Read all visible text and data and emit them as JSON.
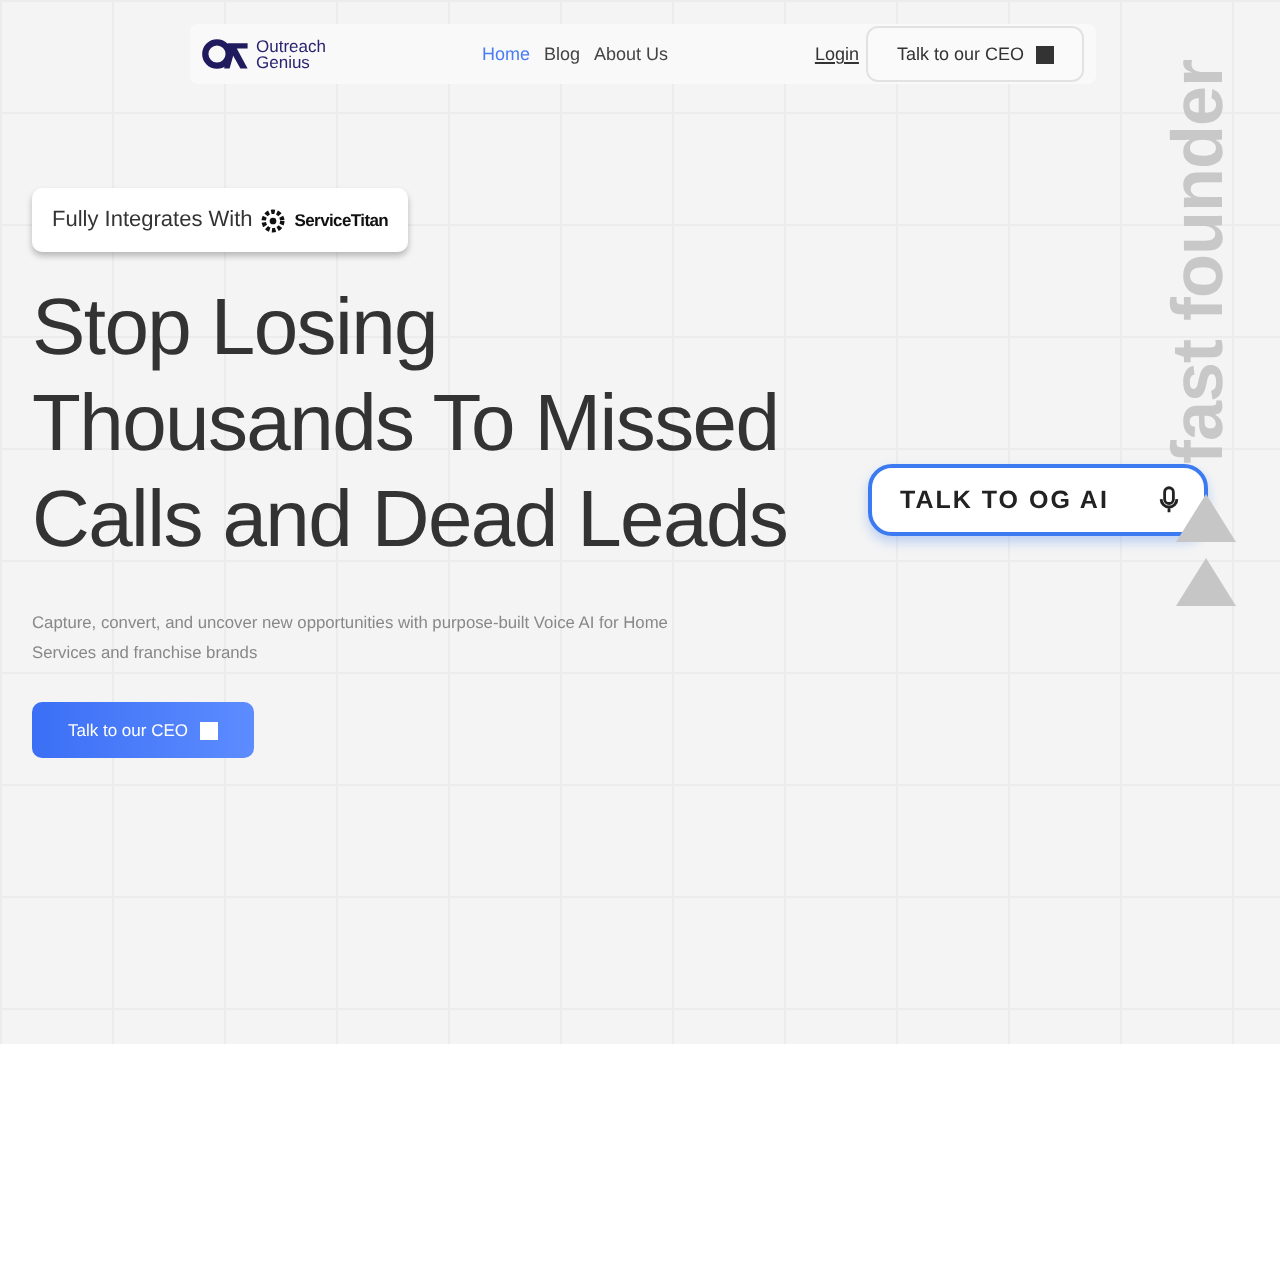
{
  "nav": {
    "logo_text": [
      "Outreach",
      "Genius"
    ],
    "links": [
      {
        "label": "Home",
        "selected": true
      },
      {
        "label": "Blog",
        "selected": false
      },
      {
        "label": "About Us",
        "selected": false
      }
    ],
    "login": "Login",
    "cta": "Talk to our CEO"
  },
  "hero": {
    "badge": {
      "text": "Fully Integrates With",
      "partner": "ServiceTitan"
    },
    "headline": [
      "Stop Losing",
      "Thousands To Missed",
      "Calls and Dead Leads"
    ],
    "subtitle": "Capture, convert, and uncover new opportunities with purpose-built Voice AI for Home Services and franchise brands",
    "cta": "Talk to our CEO"
  },
  "voice_button": "TALK TO OG AI",
  "side_brand": "fast founder"
}
